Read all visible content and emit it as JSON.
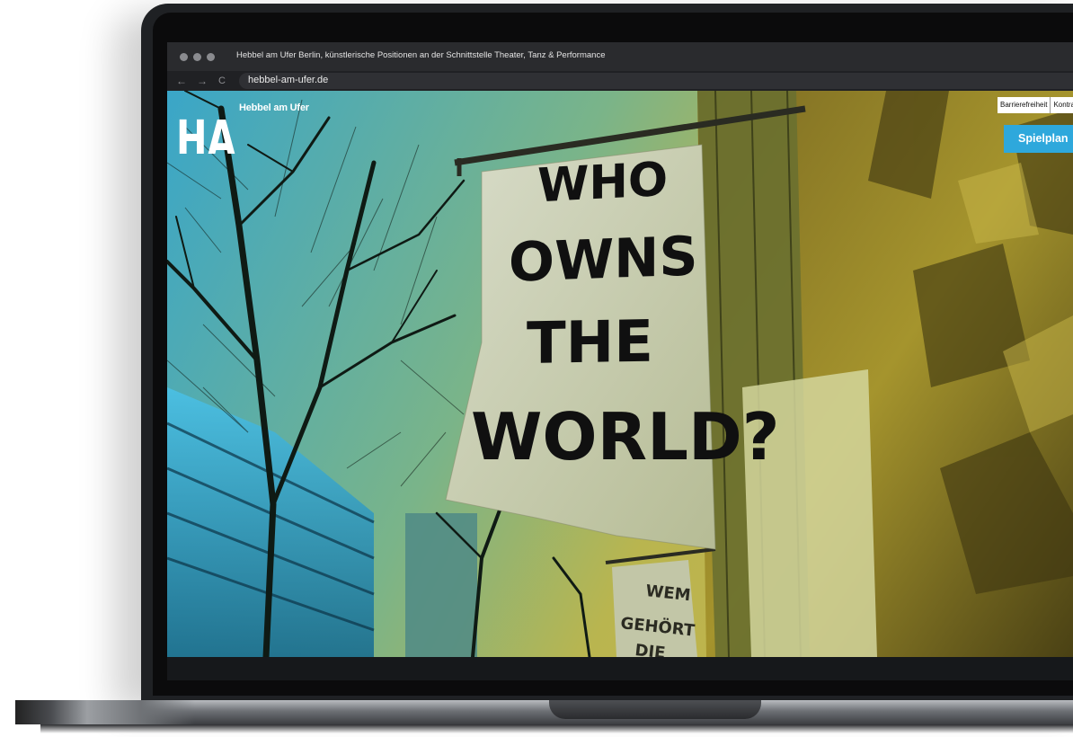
{
  "browser": {
    "tab_title": "Hebbel am Ufer Berlin, künstlerische Positionen an der Schnittstelle Theater, Tanz & Performance",
    "url": "hebbel-am-ufer.de",
    "back_icon": "←",
    "forward_icon": "→",
    "reload_icon": "C"
  },
  "site": {
    "logo_text": "HAU",
    "logo_subtitle": "Hebbel am Ufer",
    "top_links": [
      "Barrierefreiheit",
      "Kontra"
    ],
    "spielplan_label": "Spielplan",
    "banner_lines": [
      "WHO",
      "OWNS",
      "THE",
      "WORLD?"
    ],
    "small_banner_lines": [
      "WEM",
      "GEHÖRT",
      "DIE"
    ]
  },
  "colors": {
    "accent": "#2ea8dc",
    "hero_left": "#2b9fc7",
    "hero_right": "#b5a531"
  }
}
